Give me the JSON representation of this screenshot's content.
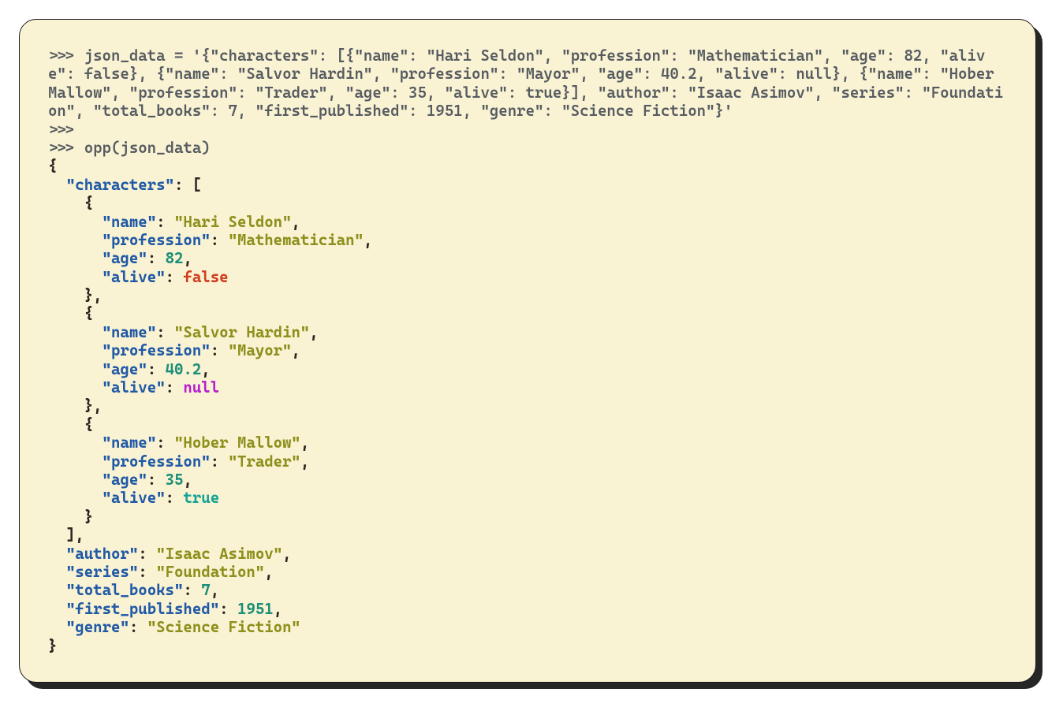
{
  "repl": {
    "prompt": ">>>",
    "assign_line": ">>> json_data = '{\"characters\": [{\"name\": \"Hari Seldon\", \"profession\": \"Mathematician\", \"age\": 82, \"alive\": false}, {\"name\": \"Salvor Hardin\", \"profession\": \"Mayor\", \"age\": 40.2, \"alive\": null}, {\"name\": \"Hober Mallow\", \"profession\": \"Trader\", \"age\": 35, \"alive\": true}], \"author\": \"Isaac Asimov\", \"series\": \"Foundation\", \"total_books\": 7, \"first_published\": 1951, \"genre\": \"Science Fiction\"}'",
    "blank_prompt": ">>>",
    "call_line": ">>> opp(json_data)"
  },
  "tokens": {
    "open_brace": "{",
    "close_brace": "}",
    "open_bracket": "[",
    "close_bracket": "]",
    "colon": ":",
    "comma": ","
  },
  "json": {
    "keys": {
      "characters": "\"characters\"",
      "name": "\"name\"",
      "profession": "\"profession\"",
      "age": "\"age\"",
      "alive": "\"alive\"",
      "author": "\"author\"",
      "series": "\"series\"",
      "total_books": "\"total_books\"",
      "first_published": "\"first_published\"",
      "genre": "\"genre\""
    },
    "characters": [
      {
        "name": "\"Hari Seldon\"",
        "profession": "\"Mathematician\"",
        "age": "82",
        "alive_type": "false",
        "alive": "false"
      },
      {
        "name": "\"Salvor Hardin\"",
        "profession": "\"Mayor\"",
        "age": "40.2",
        "alive_type": "null",
        "alive": "null"
      },
      {
        "name": "\"Hober Mallow\"",
        "profession": "\"Trader\"",
        "age": "35",
        "alive_type": "true",
        "alive": "true"
      }
    ],
    "author": "\"Isaac Asimov\"",
    "series": "\"Foundation\"",
    "total_books": "7",
    "first_published": "1951",
    "genre": "\"Science Fiction\""
  }
}
